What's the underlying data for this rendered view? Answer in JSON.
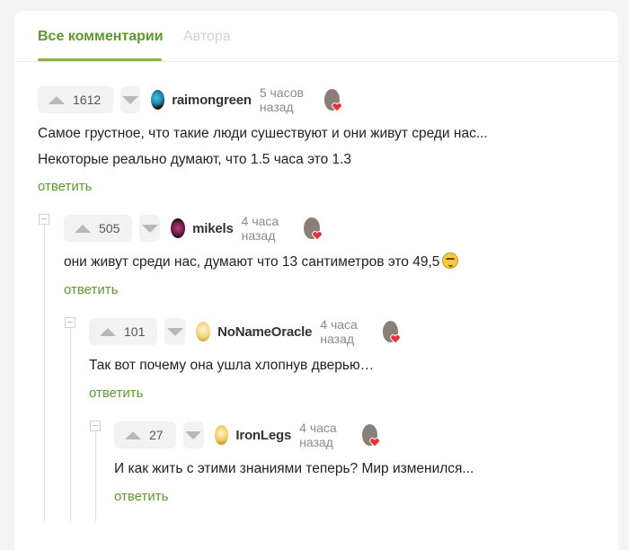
{
  "tabs": {
    "all": "Все комментарии",
    "author": "Автора"
  },
  "reply_label": "ответить",
  "comments": [
    {
      "rating": "1612",
      "user": "raimongreen",
      "time": "5 часов назад",
      "lines": [
        "Самое грустное, что такие люди сушествуют и они живут среди нас...",
        "Некоторые реально думают, что 1.5 часа это 1.3"
      ]
    },
    {
      "rating": "505",
      "user": "mikels",
      "time": "4 часа назад",
      "lines": [
        "они живут среди нас, думают что 13 сантиметров это 49,5"
      ],
      "emoji": "smirk-emoji"
    },
    {
      "rating": "101",
      "user": "NoNameOracle",
      "time": "4 часа назад",
      "lines": [
        "Так вот почему она ушла хлопнув дверью…"
      ]
    },
    {
      "rating": "27",
      "user": "IronLegs",
      "time": "4 часа назад",
      "lines": [
        "И как жить с этими знаниями теперь? Мир изменился..."
      ]
    }
  ],
  "colors": {
    "accent": "#5c9a2b",
    "underline": "#8ab23f",
    "muted": "#8a8a8a"
  }
}
